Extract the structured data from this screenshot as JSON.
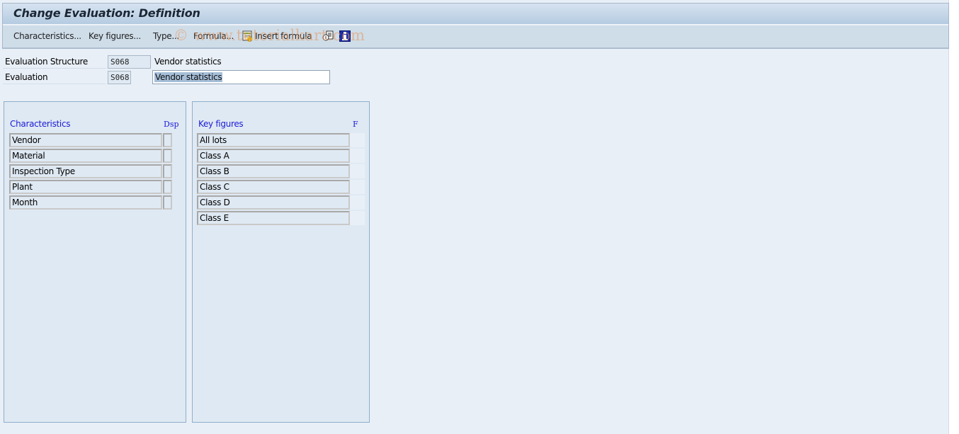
{
  "window": {
    "title": "Change Evaluation: Definition"
  },
  "toolbar": {
    "characteristics": "Characteristics...",
    "key_figures": "Key figures...",
    "type": "Type...",
    "formula": "Formula...",
    "insert_formula": "Insert formula",
    "icons": [
      "insert-formula-icon",
      "where-used-icon",
      "info-icon"
    ]
  },
  "watermark": "© www.tutorialkart.com",
  "header": {
    "eval_structure_label": "Evaluation Structure",
    "eval_structure_code": "S068",
    "eval_structure_text": "Vendor statistics",
    "evaluation_label": "Evaluation",
    "evaluation_code": "S068",
    "evaluation_text": "Vendor statistics"
  },
  "characteristics": {
    "heading": "Characteristics",
    "dsp_heading": "Dsp",
    "rows": [
      {
        "label": "Vendor",
        "dsp": false
      },
      {
        "label": "Material",
        "dsp": false
      },
      {
        "label": "Inspection Type",
        "dsp": false
      },
      {
        "label": "Plant",
        "dsp": false
      },
      {
        "label": "Month",
        "dsp": false
      }
    ]
  },
  "key_figures": {
    "heading": "Key figures",
    "f_heading": "F",
    "rows": [
      {
        "label": "All lots",
        "f": ""
      },
      {
        "label": "Class A",
        "f": ""
      },
      {
        "label": "Class B",
        "f": ""
      },
      {
        "label": "Class C",
        "f": ""
      },
      {
        "label": "Class D",
        "f": ""
      },
      {
        "label": "Class E",
        "f": ""
      }
    ]
  },
  "colors": {
    "title_gradient_top": "#d6e3f0",
    "title_gradient_bottom": "#b5cbe1",
    "column_heading": "#1a1ad6",
    "background": "#e8eff7",
    "selection": "#a5bed8"
  }
}
